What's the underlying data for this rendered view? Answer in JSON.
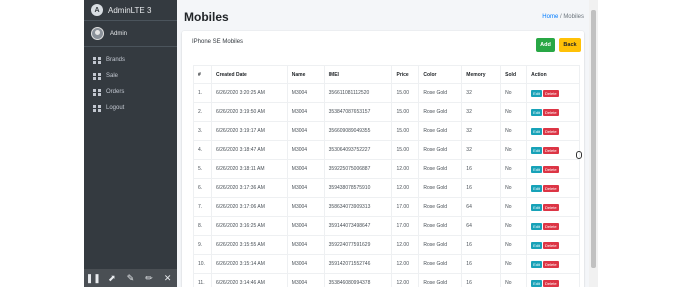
{
  "brand": {
    "name": "AdminLTE 3",
    "logo_letter": "A"
  },
  "user": {
    "name": "Admin"
  },
  "sidebar": {
    "items": [
      {
        "label": "Brands"
      },
      {
        "label": "Sale"
      },
      {
        "label": "Orders"
      },
      {
        "label": "Logout"
      }
    ]
  },
  "toolbar": {
    "tools": [
      "pause-icon",
      "pointer-icon",
      "pen-icon",
      "highlighter-icon",
      "close-icon"
    ]
  },
  "header": {
    "title": "Mobiles",
    "breadcrumb": {
      "home": "Home",
      "separator": "/",
      "current": "Mobiles"
    }
  },
  "card": {
    "title": "IPhone SE Mobiles",
    "add_label": "Add",
    "back_label": "Back"
  },
  "table": {
    "columns": [
      "#",
      "Created Date",
      "Name",
      "IMEI",
      "Price",
      "Color",
      "Memory",
      "Sold",
      "Action"
    ],
    "edit_label": "Edit",
    "delete_label": "Delete",
    "rows": [
      {
        "n": "1.",
        "date": "6/26/2020 3:20:25 AM",
        "name": "M3004",
        "imei": "356611081112520",
        "price": "15.00",
        "color": "Rose Gold",
        "memory": "32",
        "sold": "No"
      },
      {
        "n": "2.",
        "date": "6/26/2020 3:19:50 AM",
        "name": "M3004",
        "imei": "353847087653157",
        "price": "15.00",
        "color": "Rose Gold",
        "memory": "32",
        "sold": "No"
      },
      {
        "n": "3.",
        "date": "6/26/2020 3:19:17 AM",
        "name": "M3004",
        "imei": "356609089049355",
        "price": "15.00",
        "color": "Rose Gold",
        "memory": "32",
        "sold": "No"
      },
      {
        "n": "4.",
        "date": "6/26/2020 3:18:47 AM",
        "name": "M3004",
        "imei": "353064093752227",
        "price": "15.00",
        "color": "Rose Gold",
        "memory": "32",
        "sold": "No"
      },
      {
        "n": "5.",
        "date": "6/26/2020 3:18:11 AM",
        "name": "M3004",
        "imei": "359225075006887",
        "price": "12.00",
        "color": "Rose Gold",
        "memory": "16",
        "sold": "No"
      },
      {
        "n": "6.",
        "date": "6/26/2020 3:17:36 AM",
        "name": "M3004",
        "imei": "359438078575910",
        "price": "12.00",
        "color": "Rose Gold",
        "memory": "16",
        "sold": "No"
      },
      {
        "n": "7.",
        "date": "6/26/2020 3:17:06 AM",
        "name": "M3004",
        "imei": "358634073909313",
        "price": "17.00",
        "color": "Rose Gold",
        "memory": "64",
        "sold": "No"
      },
      {
        "n": "8.",
        "date": "6/26/2020 3:16:25 AM",
        "name": "M3004",
        "imei": "359144073498647",
        "price": "17.00",
        "color": "Rose Gold",
        "memory": "64",
        "sold": "No"
      },
      {
        "n": "9.",
        "date": "6/26/2020 3:15:55 AM",
        "name": "M3004",
        "imei": "359224077591629",
        "price": "12.00",
        "color": "Rose Gold",
        "memory": "16",
        "sold": "No"
      },
      {
        "n": "10.",
        "date": "6/26/2020 3:15:14 AM",
        "name": "M3004",
        "imei": "359142071552746",
        "price": "12.00",
        "color": "Rose Gold",
        "memory": "16",
        "sold": "No"
      },
      {
        "n": "11.",
        "date": "6/26/2020 3:14:46 AM",
        "name": "M3004",
        "imei": "353846080994378",
        "price": "12.00",
        "color": "Rose Gold",
        "memory": "16",
        "sold": "No"
      }
    ]
  }
}
